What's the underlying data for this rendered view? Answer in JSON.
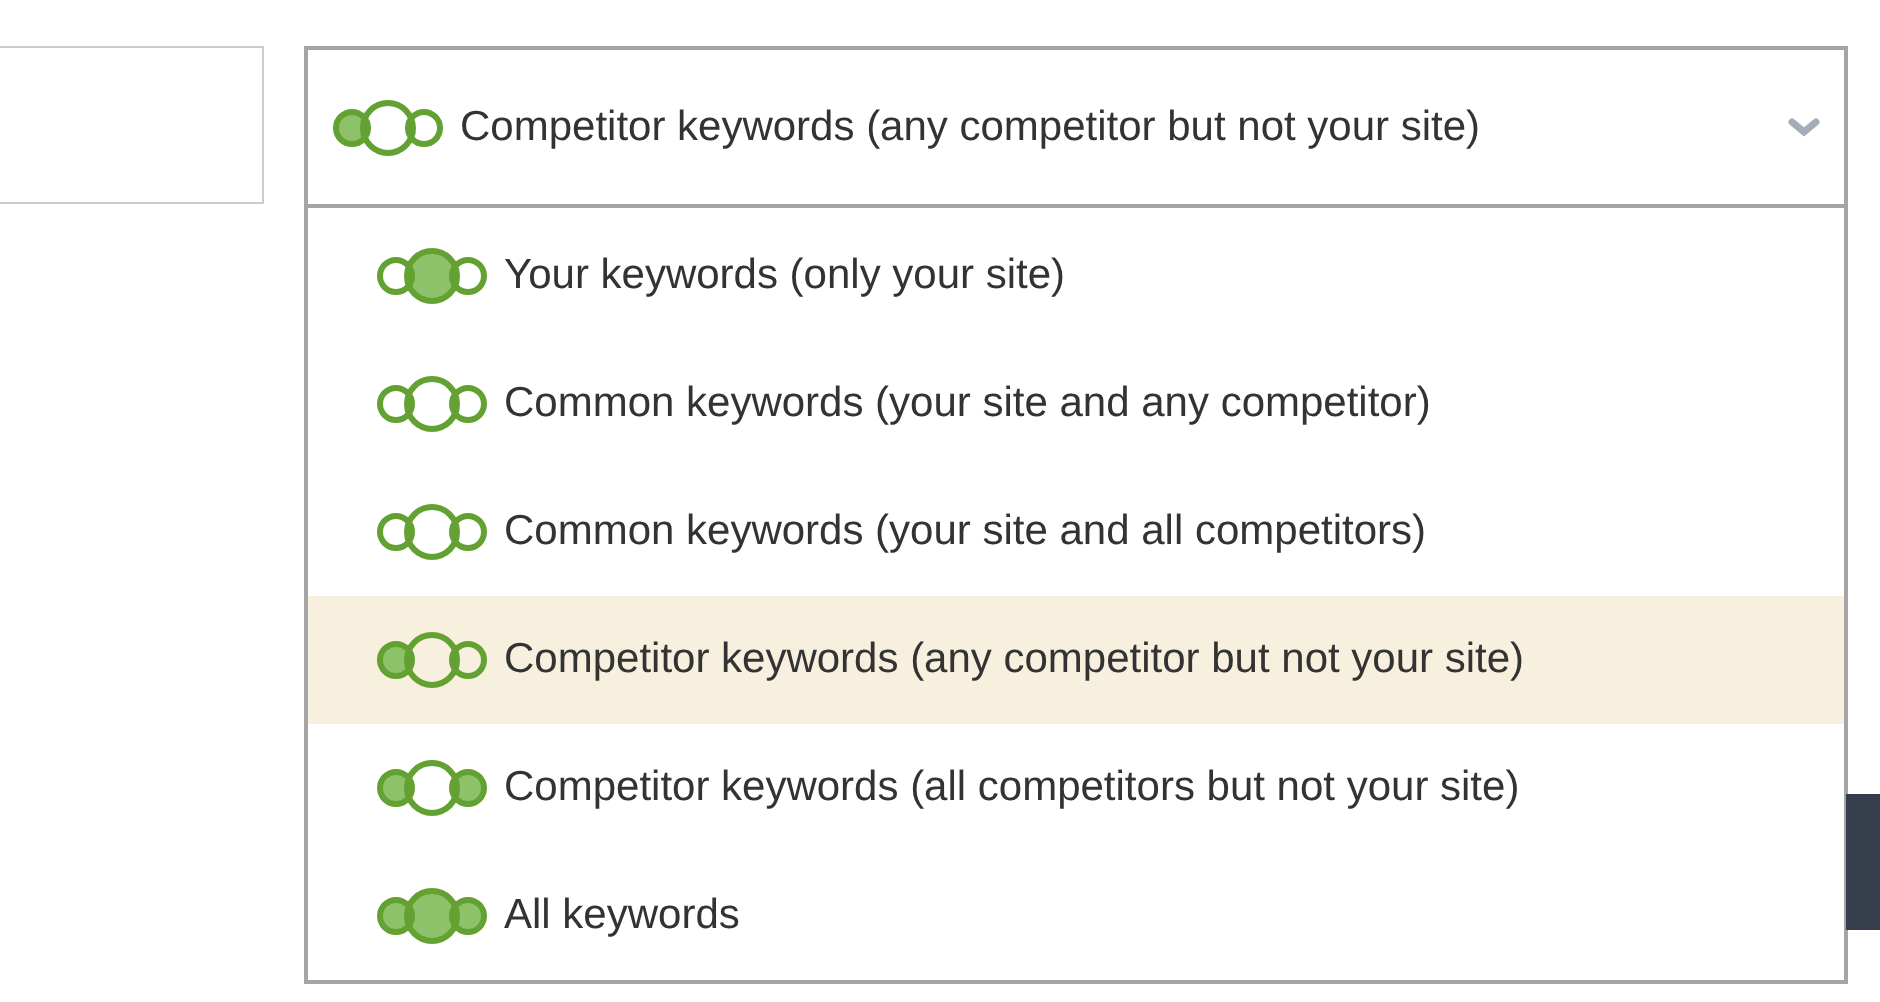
{
  "selector": {
    "value": "Competitor keywords (any competitor but not your site)",
    "kind": "competitor-any",
    "expanded": true
  },
  "options": [
    {
      "label": "Your keywords (only your site)",
      "kind": "only-mine",
      "selected": false
    },
    {
      "label": "Common keywords (your site and any competitor)",
      "kind": "common-any",
      "selected": false
    },
    {
      "label": "Common keywords (your site and all competitors)",
      "kind": "common-all",
      "selected": false
    },
    {
      "label": "Competitor keywords (any competitor but not your site)",
      "kind": "competitor-any",
      "selected": true
    },
    {
      "label": "Competitor keywords (all competitors but not your site)",
      "kind": "competitor-all",
      "selected": false
    },
    {
      "label": "All keywords",
      "kind": "all",
      "selected": false
    }
  ]
}
